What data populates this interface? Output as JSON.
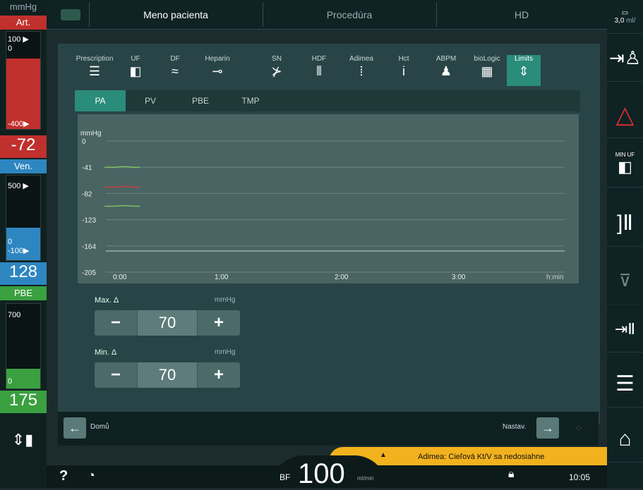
{
  "left": {
    "unit": "mmHg",
    "art": {
      "label": "Art.",
      "top": "100 ▶",
      "zero": "0",
      "low": "-400▶",
      "value": "-72"
    },
    "ven": {
      "label": "Ven.",
      "top": "500 ▶",
      "zero": "0",
      "low": "-100▶",
      "value": "128"
    },
    "pbe": {
      "label": "PBE",
      "top": "700",
      "low": "0",
      "value": "175"
    }
  },
  "topbar": {
    "patient": "Meno pacienta",
    "procedure": "Procedúra",
    "mode": "HD"
  },
  "right": {
    "top_value": "3,0",
    "top_unit": "ml/"
  },
  "tabs": [
    {
      "label": "Prescription",
      "icon": "☰"
    },
    {
      "label": "UF",
      "icon": "◧"
    },
    {
      "label": "DF",
      "icon": "≈"
    },
    {
      "label": "Heparin",
      "icon": "⊸"
    },
    {
      "label": "SN",
      "icon": "⊁"
    },
    {
      "label": "HDF",
      "icon": "⫴"
    },
    {
      "label": "Adimea",
      "icon": "⦙"
    },
    {
      "label": "Hct",
      "icon": "i"
    },
    {
      "label": "ABPM",
      "icon": "♟"
    },
    {
      "label": "bioLogic",
      "icon": "▦"
    },
    {
      "label": "Limits",
      "icon": "⇕"
    }
  ],
  "subtabs": [
    "PA",
    "PV",
    "PBE",
    "TMP"
  ],
  "chart_data": {
    "type": "line",
    "ylabel": "mmHg",
    "xlabel": "h:min",
    "yticks": [
      "0",
      "-41",
      "-82",
      "-123",
      "-164",
      "-205"
    ],
    "xticks": [
      "0:00",
      "1:00",
      "2:00",
      "3:00"
    ],
    "ylim": [
      -205,
      0
    ],
    "series": [
      {
        "color": "#7fbf5e",
        "y": [
          -41,
          -41,
          -41
        ]
      },
      {
        "color": "#c6403a",
        "y": [
          -72,
          -72,
          -72
        ]
      },
      {
        "color": "#7fbf5e",
        "y": [
          -102,
          -102,
          -102
        ]
      }
    ]
  },
  "controls": {
    "max": {
      "label": "Max. Δ",
      "unit": "mmHg",
      "value": "70"
    },
    "min": {
      "label": "Min. Δ",
      "unit": "mmHg",
      "value": "70"
    }
  },
  "nav": {
    "back": "Domů",
    "next": "Nastav."
  },
  "status": {
    "message": "Adimea: Cieľová Kt/V sa nedosiahne"
  },
  "bottom": {
    "bf_label": "BF",
    "bf_value": "100",
    "bf_unit": "ml/min",
    "time": "10:05",
    "help": "?"
  }
}
